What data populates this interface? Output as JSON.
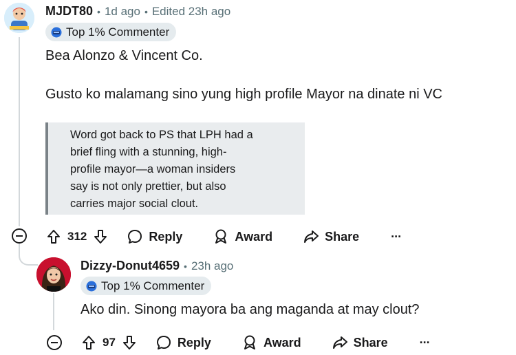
{
  "comment1": {
    "username": "MJDT80",
    "time": "1d ago",
    "edited": "Edited 23h ago",
    "flair": "Top 1% Commenter",
    "line1": "Bea Alonzo & Vincent Co.",
    "line2": "Gusto ko malamang sino yung high profile Mayor na dinate ni VC",
    "quote_lines": [
      "Word got back to PS that LPH had a",
      "brief fling with a stunning, high-",
      "profile mayor—a woman insiders",
      "say is not only prettier, but also",
      "carries major social clout."
    ],
    "votes": "312",
    "reply_label": "Reply",
    "award_label": "Award",
    "share_label": "Share",
    "more_label": "···"
  },
  "comment2": {
    "username": "Dizzy-Donut4659",
    "time": "23h ago",
    "flair": "Top 1% Commenter",
    "text": "Ako din. Sinong mayora ba ang maganda at may clout?",
    "votes": "97",
    "reply_label": "Reply",
    "award_label": "Award",
    "share_label": "Share",
    "more_label": "···"
  },
  "separator": "•",
  "colors": {
    "flair_bg": "#e5ebee",
    "quote_bg": "#e9ecee",
    "meta_gray": "#576f76"
  }
}
